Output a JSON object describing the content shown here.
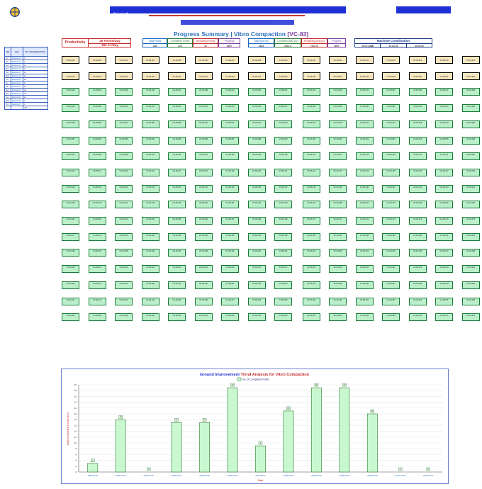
{
  "header": {
    "project_title": "Progress Summary | Vibro Compaction",
    "project_code": "[VC-83]",
    "subtitle": "Ground Improvement Works (blurred)",
    "company": "(blurred)"
  },
  "productivity": {
    "label": "Productivity",
    "points_per_day": "29 Points/Day",
    "area_per_day": "392 m²/Day"
  },
  "summary": {
    "headers": [
      "Total Points",
      "Completed Points",
      "Remaining Points",
      "Progress"
    ],
    "values": [
      "258",
      "226",
      "32",
      "88%"
    ]
  },
  "area_summary": {
    "headers": [
      "Total Area (m²)",
      "Completed Area (m²)",
      "Remaining Area (m²)",
      "Progress"
    ],
    "values": [
      "3483",
      "3051.0",
      "(432.0)",
      "88%"
    ]
  },
  "machine": {
    "title": "Machine Contribution",
    "items": [
      {
        "name": "M-001",
        "value": "226"
      },
      {
        "name": "M-002",
        "value": "0"
      },
      {
        "name": "M-003",
        "value": "0"
      }
    ]
  },
  "daily_table": {
    "headers": [
      "Day",
      "Date",
      "No. of Completed Points"
    ],
    "rows": [
      [
        "Fri",
        "2024-02-23",
        "0"
      ],
      [
        "Sat",
        "2024-02-24",
        "2"
      ],
      [
        "Sun",
        "2024-02-25",
        "12"
      ],
      [
        "Mon",
        "2024-02-26",
        "0"
      ],
      [
        "Tue",
        "2024-02-27",
        "11"
      ],
      [
        "Wed",
        "2024-02-28",
        "11"
      ],
      [
        "Thu",
        "2024-02-29",
        "29"
      ],
      [
        "Fri",
        "2024-03-01",
        "6"
      ],
      [
        "Sat",
        "2024-03-02",
        "16"
      ],
      [
        "Sun",
        "2024-03-03",
        "29"
      ],
      [
        "Mon",
        "2024-03-04",
        "29"
      ],
      [
        "Tue",
        "2024-03-05",
        "14"
      ],
      [
        "Wed",
        "2024-03-06",
        "0"
      ],
      [
        "Thu",
        "2024-03-07",
        "0"
      ]
    ],
    "total": "226"
  },
  "grid": {
    "cols": 16,
    "remaining_rows": 10,
    "prefix": "VC-83-",
    "completed_label": "(done)"
  },
  "chart_data": {
    "type": "bar",
    "title_left": "Ground Improvement",
    "title_right": "Trend Analysis for Vibro Compaction",
    "legend": "No. of Completed Points",
    "xlabel": "Date",
    "ylabel": "Daily Completed Points (Nos.)",
    "ylim": [
      0,
      30
    ],
    "yticks": [
      0,
      2,
      4,
      6,
      8,
      10,
      12,
      14,
      16,
      18,
      20,
      22,
      24,
      26,
      28,
      30
    ],
    "categories": [
      "2024-02-24",
      "2024-02-25",
      "2024-02-26",
      "2024-02-27",
      "2024-02-28",
      "2024-02-29",
      "2024-03-01",
      "2024-03-02",
      "2024-03-03",
      "2024-03-04",
      "2024-03-05",
      "2024-03-06",
      "2024-03-07"
    ],
    "values": [
      3,
      18,
      0,
      17,
      17,
      29,
      9,
      21,
      29,
      29,
      20,
      0,
      0
    ],
    "bar_fill": "#c9f7cf",
    "bar_stroke": "#2e7d32",
    "title_colors": [
      "#1f2fd6",
      "#c62828"
    ]
  }
}
